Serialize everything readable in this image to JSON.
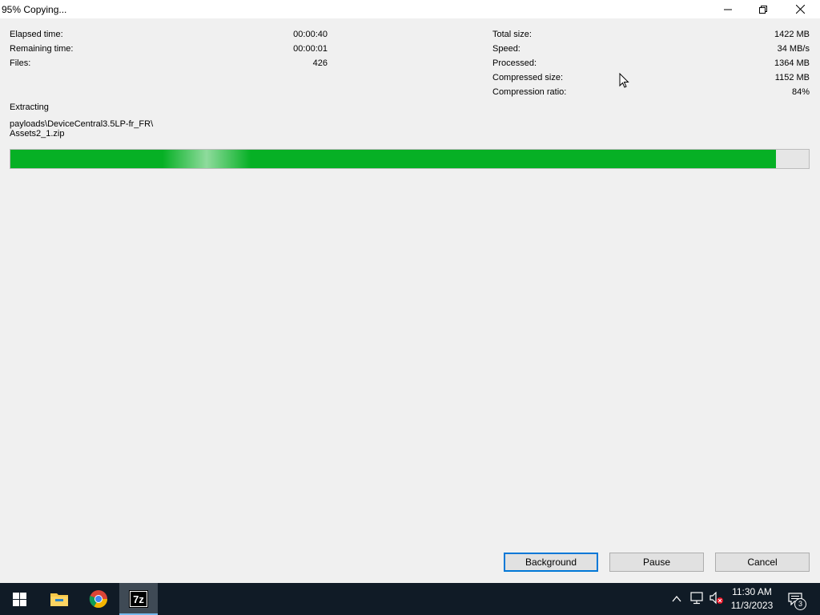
{
  "window": {
    "title": "95% Copying..."
  },
  "stats_left": [
    {
      "label": "Elapsed time:",
      "value": "00:00:40"
    },
    {
      "label": "Remaining time:",
      "value": "00:00:01"
    },
    {
      "label": "Files:",
      "value": "426"
    }
  ],
  "stats_right": [
    {
      "label": "Total size:",
      "value": "1422 MB"
    },
    {
      "label": "Speed:",
      "value": "34 MB/s"
    },
    {
      "label": "Processed:",
      "value": "1364 MB"
    },
    {
      "label": "Compressed size:",
      "value": "1152 MB"
    },
    {
      "label": "Compression ratio:",
      "value": "84%"
    }
  ],
  "operation": {
    "label": "Extracting",
    "path_line1": "payloads\\DeviceCentral3.5LP-fr_FR\\",
    "path_line2": "Assets2_1.zip"
  },
  "progress": {
    "fraction": 0.959,
    "color": "#06b025"
  },
  "buttons": {
    "background": "Background",
    "pause": "Pause",
    "cancel": "Cancel"
  },
  "taskbar": {
    "pinned": [
      "windows-start-icon",
      "file-explorer-icon",
      "chrome-icon",
      "7zip-icon"
    ],
    "clock_time": "11:30 AM",
    "clock_date": "11/3/2023",
    "notification_count": "3"
  }
}
